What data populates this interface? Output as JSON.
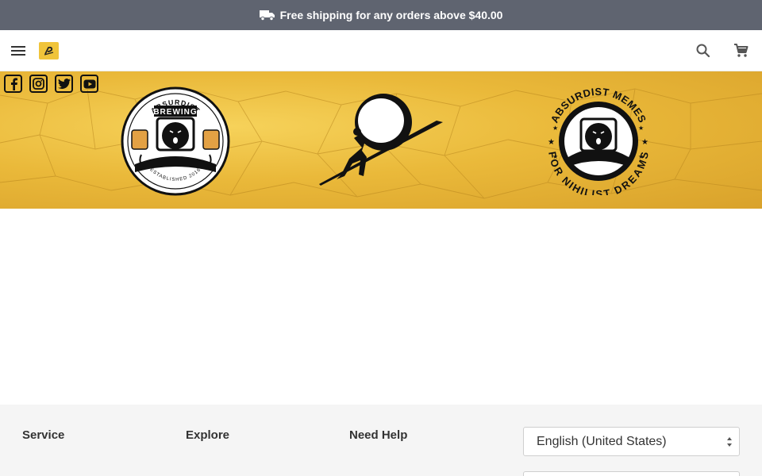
{
  "announcement": {
    "text": "Free shipping for any orders above $40.00",
    "icon": "truck-icon"
  },
  "header": {
    "menu_icon": "hamburger-menu-icon",
    "logo_icon": "store-logo",
    "search_icon": "search-icon",
    "cart_icon": "shopping-cart-icon"
  },
  "banner": {
    "social": [
      "facebook-icon",
      "instagram-icon",
      "twitter-icon",
      "youtube-icon"
    ],
    "left_badge": {
      "top_text": "ABSURDIST",
      "middle_text": "BREWING",
      "bottom_text": "ESTABLISHED 2016"
    },
    "right_badge": {
      "top_text": "ABSURDIST MEMES",
      "bottom_text": "FOR NIHILIST DREAMS"
    }
  },
  "footer": {
    "columns": [
      "Service",
      "Explore",
      "Need Help"
    ],
    "language": "English (United States)"
  },
  "colors": {
    "announcement_bg": "#5f6470",
    "banner_yellow": "#eab93a",
    "footer_bg": "#f5f5f5"
  }
}
